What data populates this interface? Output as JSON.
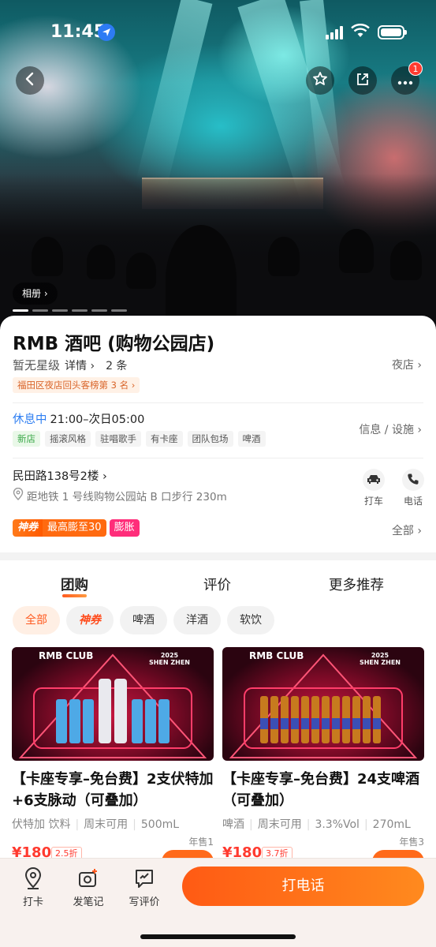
{
  "status": {
    "time": "11:45"
  },
  "hero": {
    "album_label": "相册 ›",
    "notification_count": "1"
  },
  "venue": {
    "name": "RMB 酒吧 (购物公园店)",
    "star_level": "暂无星级",
    "detail_link": "详情 ›",
    "review_count": "2 条",
    "category": "夜店 ›",
    "rank_tag": "福田区夜店回头客榜第 3 名 ›",
    "status": "休息中",
    "hours": "21:00–次日05:00",
    "tags": [
      "新店",
      "摇滚风格",
      "驻唱歌手",
      "有卡座",
      "团队包场",
      "啤酒"
    ],
    "info_link": "信息 / 设施 ›",
    "address": "民田路138号2楼 ›",
    "metro": "距地铁 1 号线购物公园站 B 口步行 230m",
    "actions": {
      "taxi": "打车",
      "phone": "电话"
    },
    "promo": {
      "badge": "神券",
      "max": "最高膨至30",
      "expand": "膨胀"
    },
    "all_link": "全部 ›"
  },
  "tabs": [
    "团购",
    "评价",
    "更多推荐"
  ],
  "filters": [
    "全部",
    "神券",
    "啤酒",
    "洋酒",
    "软饮"
  ],
  "products": [
    {
      "brand": "RMB CLUB",
      "badge": "2025\nSHEN ZHEN",
      "title": "【卡座专享–免台费】2支伏特加+6支脉动（可叠加）",
      "meta": [
        "伏特加 饮料",
        "周末可用",
        "500mL"
      ],
      "sold": "年售1",
      "price": "¥180",
      "discount": "2.5折"
    },
    {
      "brand": "RMB CLUB",
      "badge": "2025\nSHEN ZHEN",
      "title": "【卡座专享–免台费】24支啤酒（可叠加）",
      "meta": [
        "啤酒",
        "周末可用",
        "3.3%Vol",
        "270mL"
      ],
      "sold": "年售3",
      "price": "¥180",
      "discount": "3.7折"
    }
  ],
  "bottom_bar": {
    "checkin": "打卡",
    "note": "发笔记",
    "review": "写评价",
    "call": "打电话"
  },
  "colors": {
    "accent": "#ff5a1f",
    "blue_status": "#2f7ff2",
    "promo_pink": "#ff2d7a"
  }
}
